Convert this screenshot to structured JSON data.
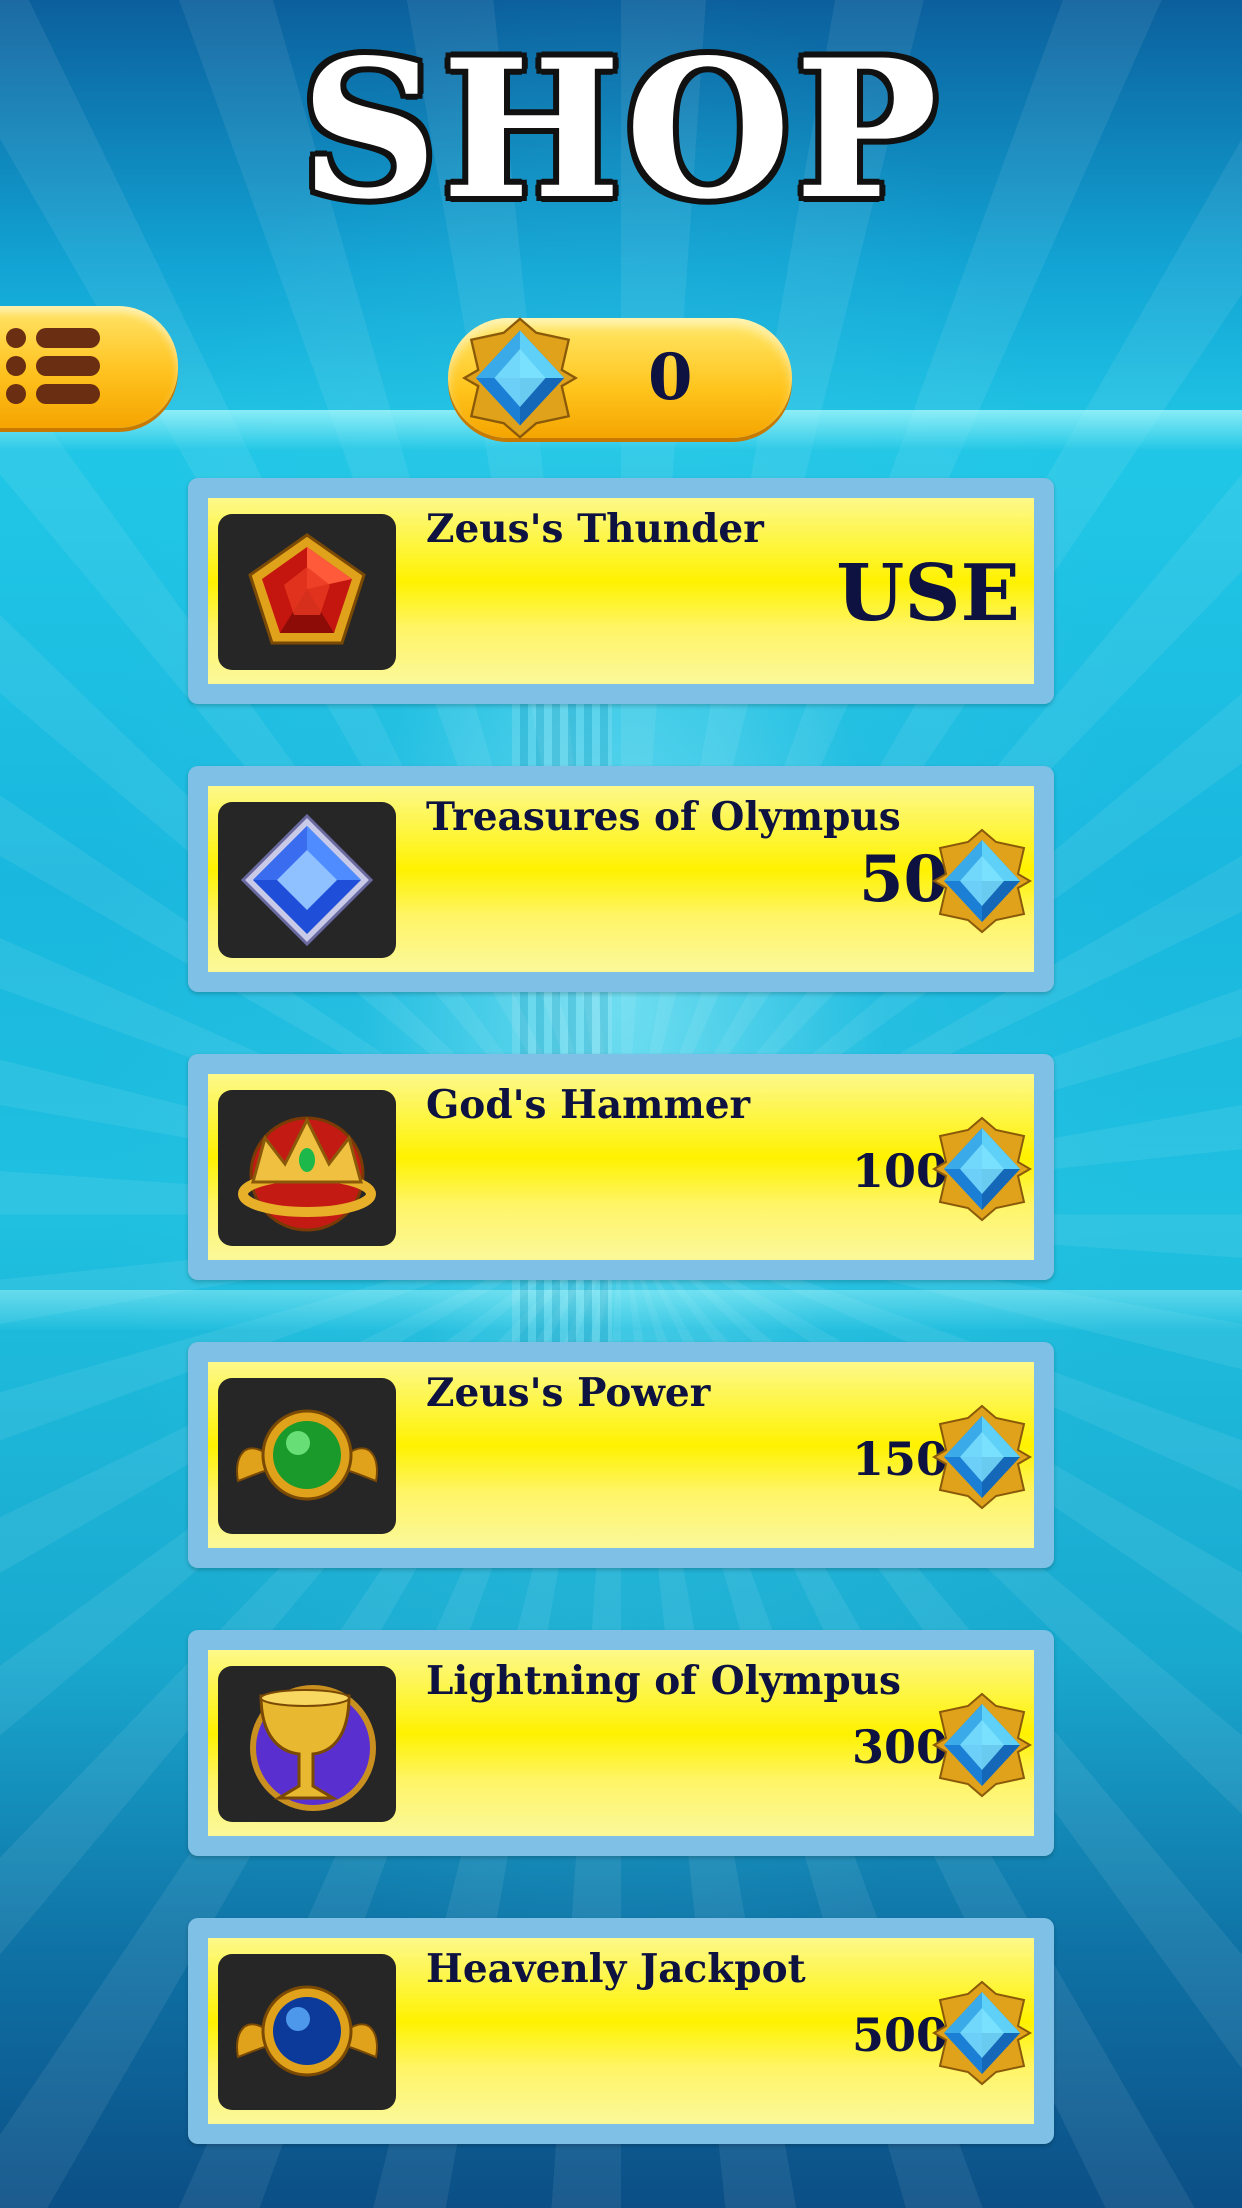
{
  "header": {
    "title": "SHOP"
  },
  "menu": {
    "icon": "list-menu-icon"
  },
  "balance": {
    "value": "0",
    "icon": "blue-gem-icon"
  },
  "items": [
    {
      "name": "Zeus's Thunder",
      "action": "USE",
      "icon": "red-pentagon-gem-icon"
    },
    {
      "name": "Treasures of Olympus",
      "price": "50",
      "icon": "blue-diamond-gem-icon"
    },
    {
      "name": "God's Hammer",
      "price": "100",
      "icon": "golden-crown-icon"
    },
    {
      "name": "Zeus's Power",
      "price": "150",
      "icon": "green-winged-orb-icon"
    },
    {
      "name": "Lightning of Olympus",
      "price": "300",
      "icon": "golden-chalice-icon"
    },
    {
      "name": "Heavenly Jackpot",
      "price": "500",
      "icon": "blue-winged-orb-icon"
    }
  ],
  "colors": {
    "card_yellow": "#fef200",
    "card_border": "#7fc1e6",
    "text_navy": "#0d1240",
    "button_orange": "#ffc21e"
  }
}
